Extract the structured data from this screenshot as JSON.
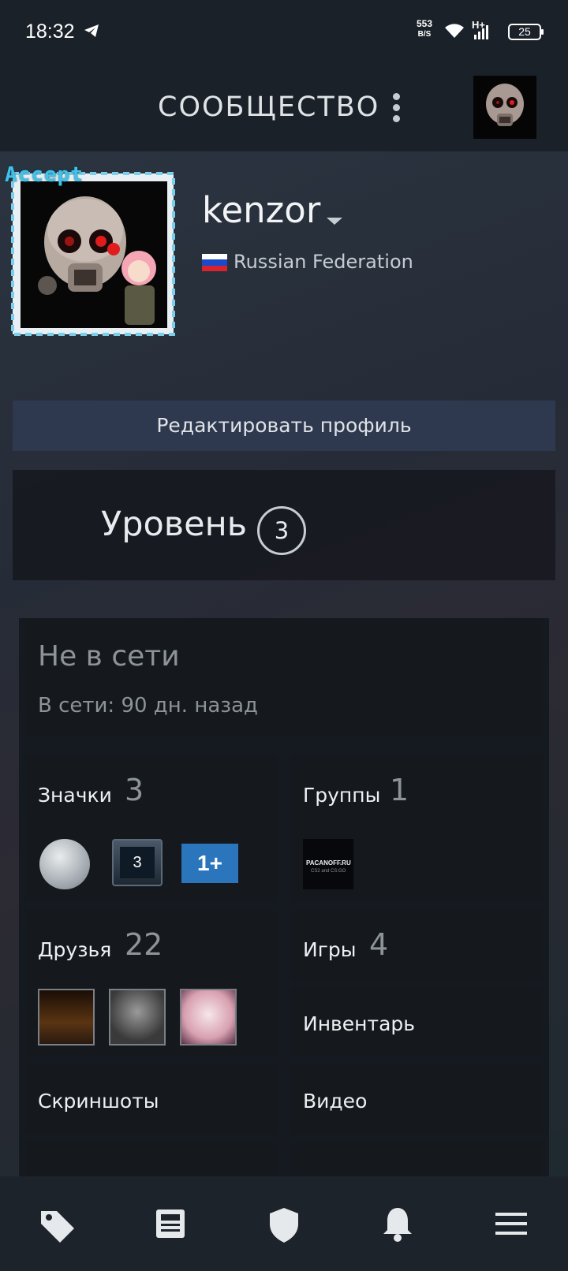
{
  "status_bar": {
    "time": "18:32",
    "speed_value": "553",
    "speed_unit": "B/S",
    "network": "H+",
    "battery": "25"
  },
  "header": {
    "title": "СООБЩЕСТВО"
  },
  "profile": {
    "frame_text": "Accept",
    "username": "kenzor",
    "country": "Russian Federation",
    "flag_colors": [
      "#ffffff",
      "#1a49c9",
      "#d8232f"
    ]
  },
  "edit_profile_label": "Редактировать профиль",
  "level": {
    "label": "Уровень",
    "value": "3"
  },
  "status": {
    "state": "Не в сети",
    "last_online": "В сети: 90 дн. назад"
  },
  "tiles": {
    "badges": {
      "label": "Значки",
      "count": "3",
      "badge_level": "3",
      "badge_years": "1+"
    },
    "groups": {
      "label": "Группы",
      "count": "1",
      "group_name": "PACANOFF.RU",
      "group_sub": "CS2 and CS:GO"
    },
    "friends": {
      "label": "Друзья",
      "count": "22"
    },
    "games": {
      "label": "Игры",
      "count": "4"
    },
    "inventory": {
      "label": "Инвентарь"
    },
    "screenshots": {
      "label": "Скриншоты"
    },
    "videos": {
      "label": "Видео"
    }
  },
  "bottom_nav": [
    "tag-icon",
    "news-icon",
    "shield-icon",
    "bell-icon",
    "menu-icon"
  ],
  "colors": {
    "accent": "#2e3950",
    "background": "#1b2128",
    "tile": "#15191e",
    "muted_text": "#8c9399"
  }
}
